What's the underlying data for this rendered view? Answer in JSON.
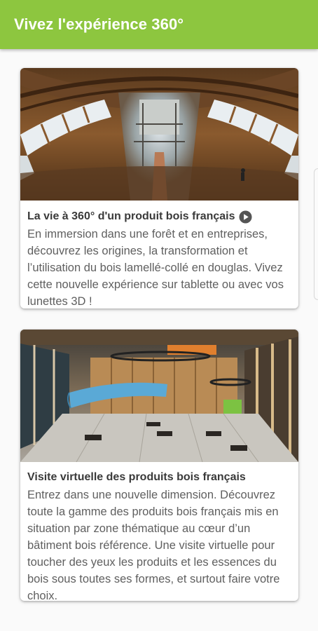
{
  "appbar": {
    "title": "Vivez l'expérience 360°"
  },
  "cards": [
    {
      "title": "La vie à 360° d'un produit bois français",
      "icon": "play-circle-icon",
      "description": "En immersion dans une forêt et en entreprises, découvrez les origines, la transformation et l’utilisation du bois lamellé-collé en douglas. Vivez cette nouvelle expérience sur tablette ou avec vos lunettes 3D !"
    },
    {
      "title": "Visite virtuelle des produits bois français",
      "description": "Entrez dans une nouvelle dimension. Découvrez toute la gamme des produits bois français mis en situation par zone thématique au cœur d’un bâtiment bois référence. Une visite virtuelle pour toucher des yeux les produits et les essences du bois sous toutes ses formes, et surtout faire votre choix."
    }
  ],
  "colors": {
    "appbar": "#8dc63f",
    "title_text": "#3a3a3a",
    "body_text": "#5f5f5f"
  }
}
